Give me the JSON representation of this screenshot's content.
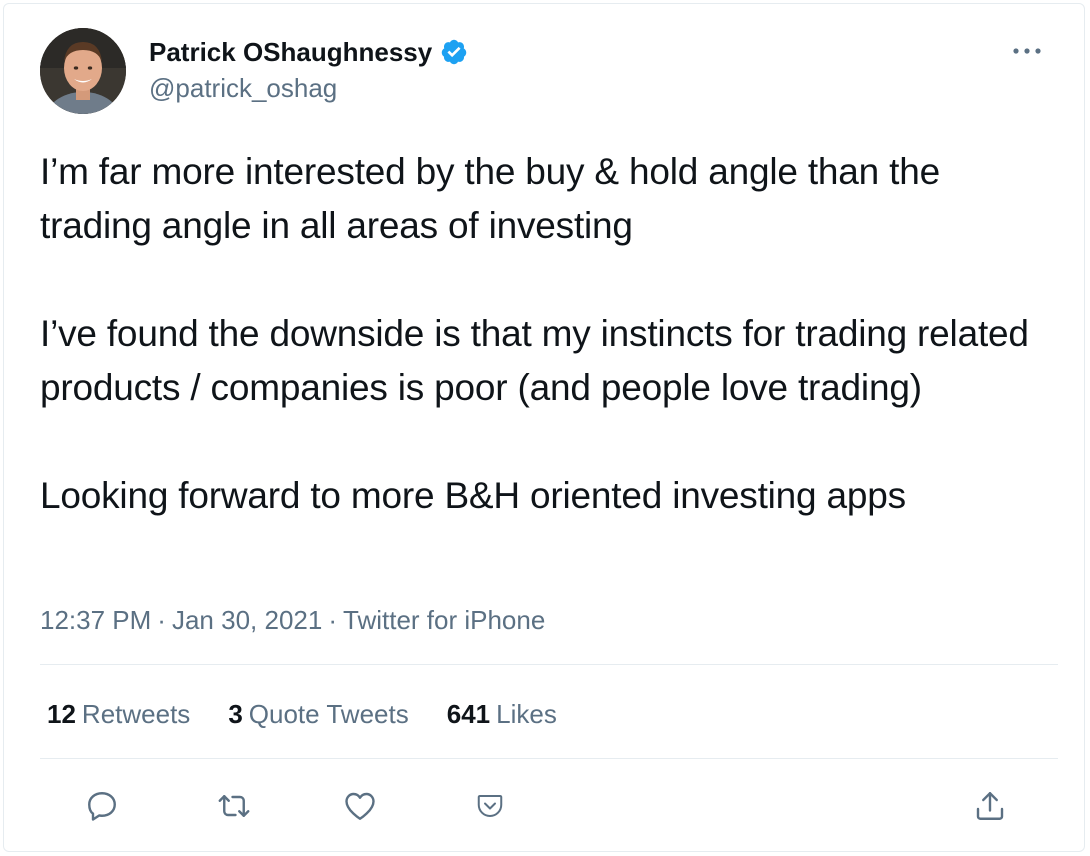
{
  "user": {
    "display_name": "Patrick OShaughnessy",
    "handle": "@patrick_oshag",
    "verified": true
  },
  "tweet": {
    "paragraphs": [
      "I’m far more interested by the buy & hold angle than the trading angle in all areas of investing",
      "I’ve found the downside is that my instincts for trading related products / companies is poor (and people love trading)",
      "Looking forward to more B&H oriented investing apps"
    ],
    "time": "12:37 PM",
    "date": "Jan 30, 2021",
    "source": "Twitter for iPhone",
    "separator": "·"
  },
  "stats": {
    "retweets_count": "12",
    "retweets_label": "Retweets",
    "quotes_count": "3",
    "quotes_label": "Quote Tweets",
    "likes_count": "641",
    "likes_label": "Likes"
  },
  "icons": {
    "more": "more-horizontal-icon",
    "reply": "reply-icon",
    "retweet": "retweet-icon",
    "like": "heart-icon",
    "save": "pocket-save-icon",
    "share": "share-icon"
  },
  "colors": {
    "text": "#0f1419",
    "secondary": "#5b7083",
    "verified": "#1da1f2",
    "border": "#e6ecf0",
    "pocket": "#ef4056"
  }
}
